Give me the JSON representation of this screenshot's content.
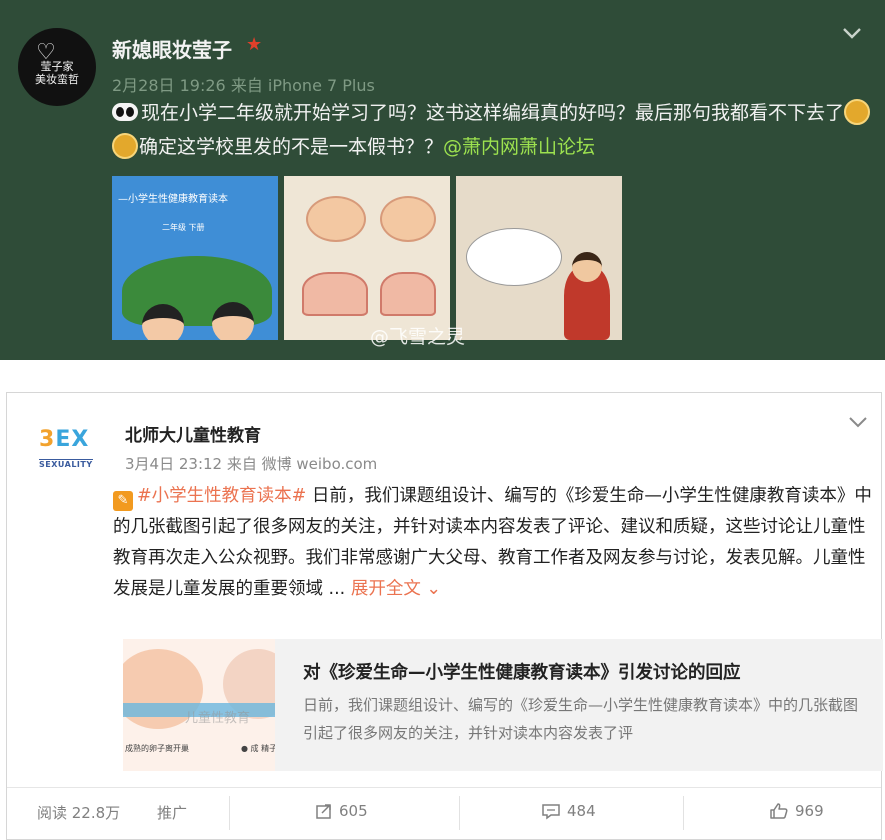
{
  "post1": {
    "avatar_text": "莹子家\n美妆蛮哲",
    "username": "新媳眼妆莹子",
    "meta": "2月28日 19:26 来自 iPhone 7 Plus",
    "text_part1": "现在小学二年级就开始学习了吗？这书这样编缉真的好吗？最后那句我都看不下去了",
    "text_part2": "确定这学校里发的不是一本假书？？",
    "mention": "@萧内网萧山论坛",
    "thumb1_title": "—小学生性健康教育读本",
    "thumb1_sub": "二年级  下册",
    "watermark": "@飞雪之灵"
  },
  "post2": {
    "logo_mark_a": "3",
    "logo_mark_b": "EX",
    "logo_word": "SEXUALITY",
    "username": "北师大儿童性教育",
    "meta": "3月4日 23:12 来自 微博 weibo.com",
    "hashtag": "#小学生性教育读本#",
    "text": " 日前，我们课题组设计、编写的《珍爱生命—小学生性健康教育读本》中的几张截图引起了很多网友的关注，并针对读本内容发表了评论、建议和质疑，这些讨论让儿童性教育再次走入公众视野。我们非常感谢广大父母、教育工作者及网友参与讨论，发表见解。儿童性发展是儿童发展的重要领域 ... ",
    "expand": "展开全文",
    "card": {
      "thumb_watermark": "儿童性教育",
      "thumb_caption": "成熟的卵子离开巢  ",
      "thumb_caption2": "● 成  精子",
      "title": "对《珍爱生命—小学生性健康教育读本》引发讨论的回应",
      "desc": "日前，我们课题组设计、编写的《珍爱生命—小学生性健康教育读本》中的几张截图引起了很多网友的关注，并针对读本内容发表了评"
    },
    "actions": {
      "reads": "阅读 22.8万",
      "promote": "推广",
      "repost": "605",
      "comment": "484",
      "like": "969"
    }
  }
}
